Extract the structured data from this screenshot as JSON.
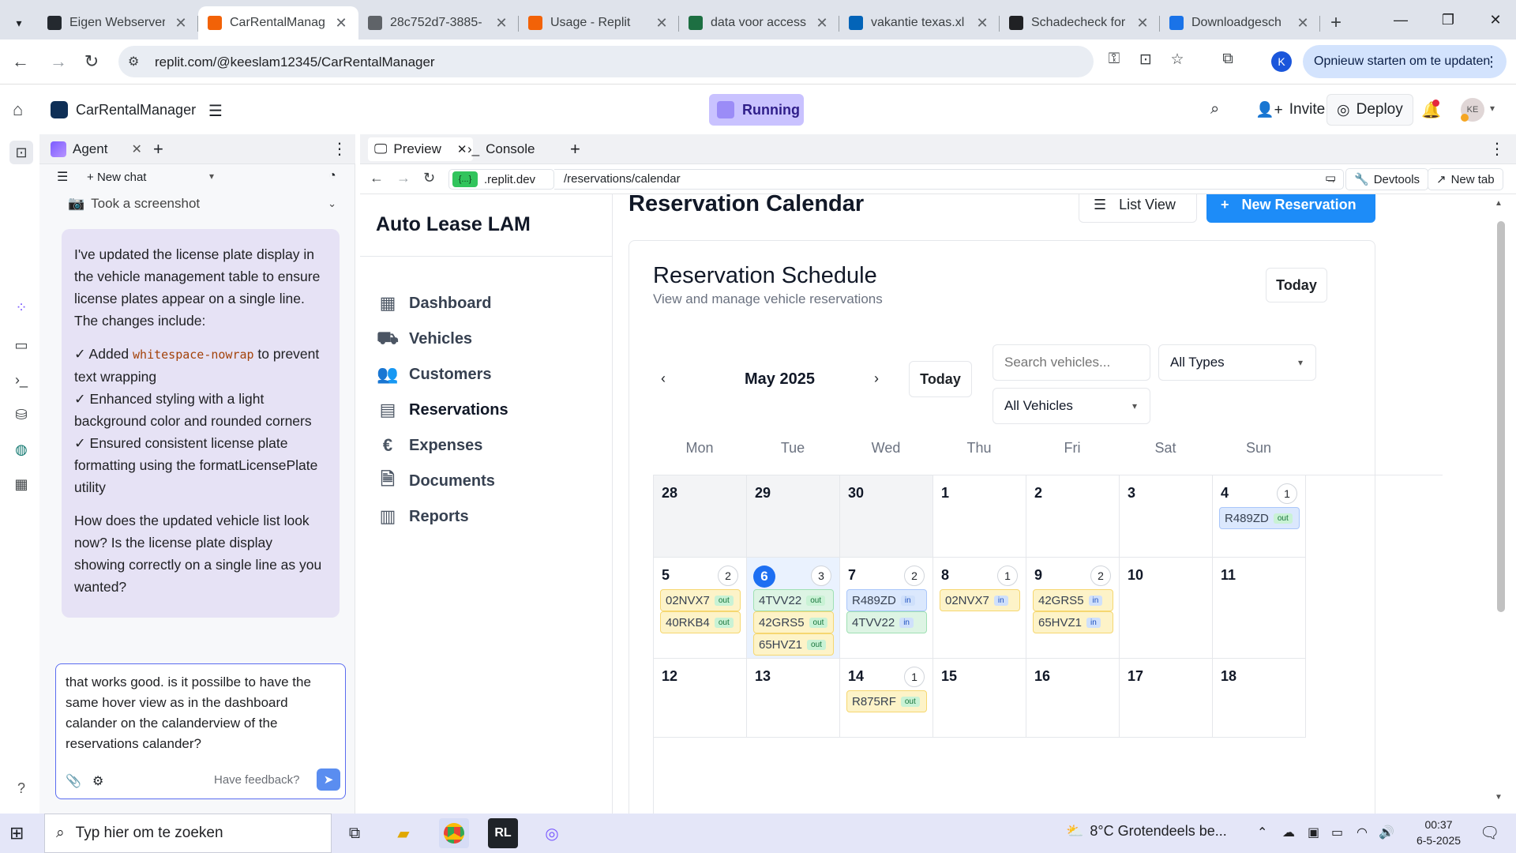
{
  "browser": {
    "tabs": [
      {
        "title": "Eigen Webserver",
        "favicon": "github-icon",
        "color": "#24292f"
      },
      {
        "title": "CarRentalManag",
        "favicon": "replit-icon",
        "color": "#f26207",
        "active": true
      },
      {
        "title": "28c752d7-3885-",
        "favicon": "globe-icon",
        "color": "#5f6368"
      },
      {
        "title": "Usage - Replit",
        "favicon": "replit-icon",
        "color": "#f26207"
      },
      {
        "title": "data voor access",
        "favicon": "excel-icon",
        "color": "#1d6f42"
      },
      {
        "title": "vakantie texas.xl",
        "favicon": "onedrive-icon",
        "color": "#0364b8"
      },
      {
        "title": "Schadecheck for",
        "favicon": "openai-icon",
        "color": "#202124"
      },
      {
        "title": "Downloadgesch",
        "favicon": "download-icon",
        "color": "#1a73e8"
      }
    ],
    "url": "replit.com/@keeslam12345/CarRentalManager",
    "update_label": "Opnieuw starten om te updaten",
    "profile_initial": "K"
  },
  "replit": {
    "project_name": "CarRentalManager",
    "status": "Running",
    "invite_label": "Invite",
    "deploy_label": "Deploy",
    "avatar_initials": "KE"
  },
  "agent": {
    "tab_label": "Agent",
    "new_chat_label": "New chat",
    "screenshot_label": "Took a screenshot",
    "message": {
      "intro": "I've updated the license plate display in the vehicle management table to ensure license plates appear on a single line. The changes include:",
      "item1_prefix": "✓ Added ",
      "item1_code": "whitespace-nowrap",
      "item1_suffix": " to prevent text wrapping",
      "item2": "✓ Enhanced styling with a light background color and rounded corners",
      "item3": "✓ Ensured consistent license plate formatting using the formatLicensePlate utility",
      "question": "How does the updated vehicle list look now? Is the license plate display showing correctly on a single line as you wanted?"
    },
    "input_text": "that works good. is it possilbe to have the same hover view as in the dashboard calander on the calanderview of the reservations calander?",
    "feedback_label": "Have feedback?"
  },
  "preview": {
    "tabs": [
      "Preview",
      "Console"
    ],
    "domain": ".replit.dev",
    "domain_badge": "{...}",
    "path": "/reservations/calendar",
    "devtools_label": "Devtools",
    "newtab_label": "New tab"
  },
  "app": {
    "brand": "Auto Lease LAM",
    "nav": [
      {
        "label": "Dashboard",
        "icon": "dashboard-icon"
      },
      {
        "label": "Vehicles",
        "icon": "car-icon"
      },
      {
        "label": "Customers",
        "icon": "users-icon"
      },
      {
        "label": "Reservations",
        "icon": "calendar-icon",
        "active": true
      },
      {
        "label": "Expenses",
        "icon": "euro-icon"
      },
      {
        "label": "Documents",
        "icon": "document-icon"
      },
      {
        "label": "Reports",
        "icon": "chart-icon"
      }
    ],
    "page_title": "Reservation Calendar",
    "list_view_label": "List View",
    "new_reservation_label": "New Reservation",
    "schedule_title": "Reservation Schedule",
    "schedule_subtitle": "View and manage vehicle reservations",
    "today_label": "Today",
    "month_label": "May 2025",
    "search_placeholder": "Search vehicles...",
    "type_filter": "All Types",
    "vehicle_filter": "All Vehicles",
    "weekdays": [
      "Mon",
      "Tue",
      "Wed",
      "Thu",
      "Fri",
      "Sat",
      "Sun"
    ],
    "weeks": [
      [
        {
          "day": "28",
          "prev": true
        },
        {
          "day": "29",
          "prev": true
        },
        {
          "day": "30",
          "prev": true
        },
        {
          "day": "1"
        },
        {
          "day": "2"
        },
        {
          "day": "3"
        },
        {
          "day": "4",
          "count": "1",
          "items": [
            {
              "plate": "R489ZD",
              "status": "out",
              "style": "in-b"
            }
          ]
        }
      ],
      [
        {
          "day": "5",
          "count": "2",
          "items": [
            {
              "plate": "02NVX7",
              "status": "out",
              "style": "out-y"
            },
            {
              "plate": "40RKB4",
              "status": "out",
              "style": "out-y"
            }
          ]
        },
        {
          "day": "6",
          "today": true,
          "count": "3",
          "items": [
            {
              "plate": "4TVV22",
              "status": "out",
              "style": "g"
            },
            {
              "plate": "42GRS5",
              "status": "out",
              "style": "out-y"
            },
            {
              "plate": "65HVZ1",
              "status": "out",
              "style": "out-y"
            }
          ]
        },
        {
          "day": "7",
          "count": "2",
          "items": [
            {
              "plate": "R489ZD",
              "status": "in",
              "style": "in-b"
            },
            {
              "plate": "4TVV22",
              "status": "in",
              "style": "g"
            }
          ]
        },
        {
          "day": "8",
          "count": "1",
          "items": [
            {
              "plate": "02NVX7",
              "status": "in",
              "style": "in-y"
            }
          ]
        },
        {
          "day": "9",
          "count": "2",
          "items": [
            {
              "plate": "42GRS5",
              "status": "in",
              "style": "in-y"
            },
            {
              "plate": "65HVZ1",
              "status": "in",
              "style": "in-y"
            }
          ]
        },
        {
          "day": "10"
        },
        {
          "day": "11"
        }
      ],
      [
        {
          "day": "12"
        },
        {
          "day": "13"
        },
        {
          "day": "14",
          "count": "1",
          "items": [
            {
              "plate": "R875RF",
              "status": "out",
              "style": "out-y"
            }
          ]
        },
        {
          "day": "15"
        },
        {
          "day": "16"
        },
        {
          "day": "17"
        },
        {
          "day": "18"
        }
      ]
    ]
  },
  "taskbar": {
    "search_placeholder": "Typ hier om te zoeken",
    "weather": "8°C  Grotendeels be...",
    "time": "00:37",
    "date": "6-5-2025"
  }
}
